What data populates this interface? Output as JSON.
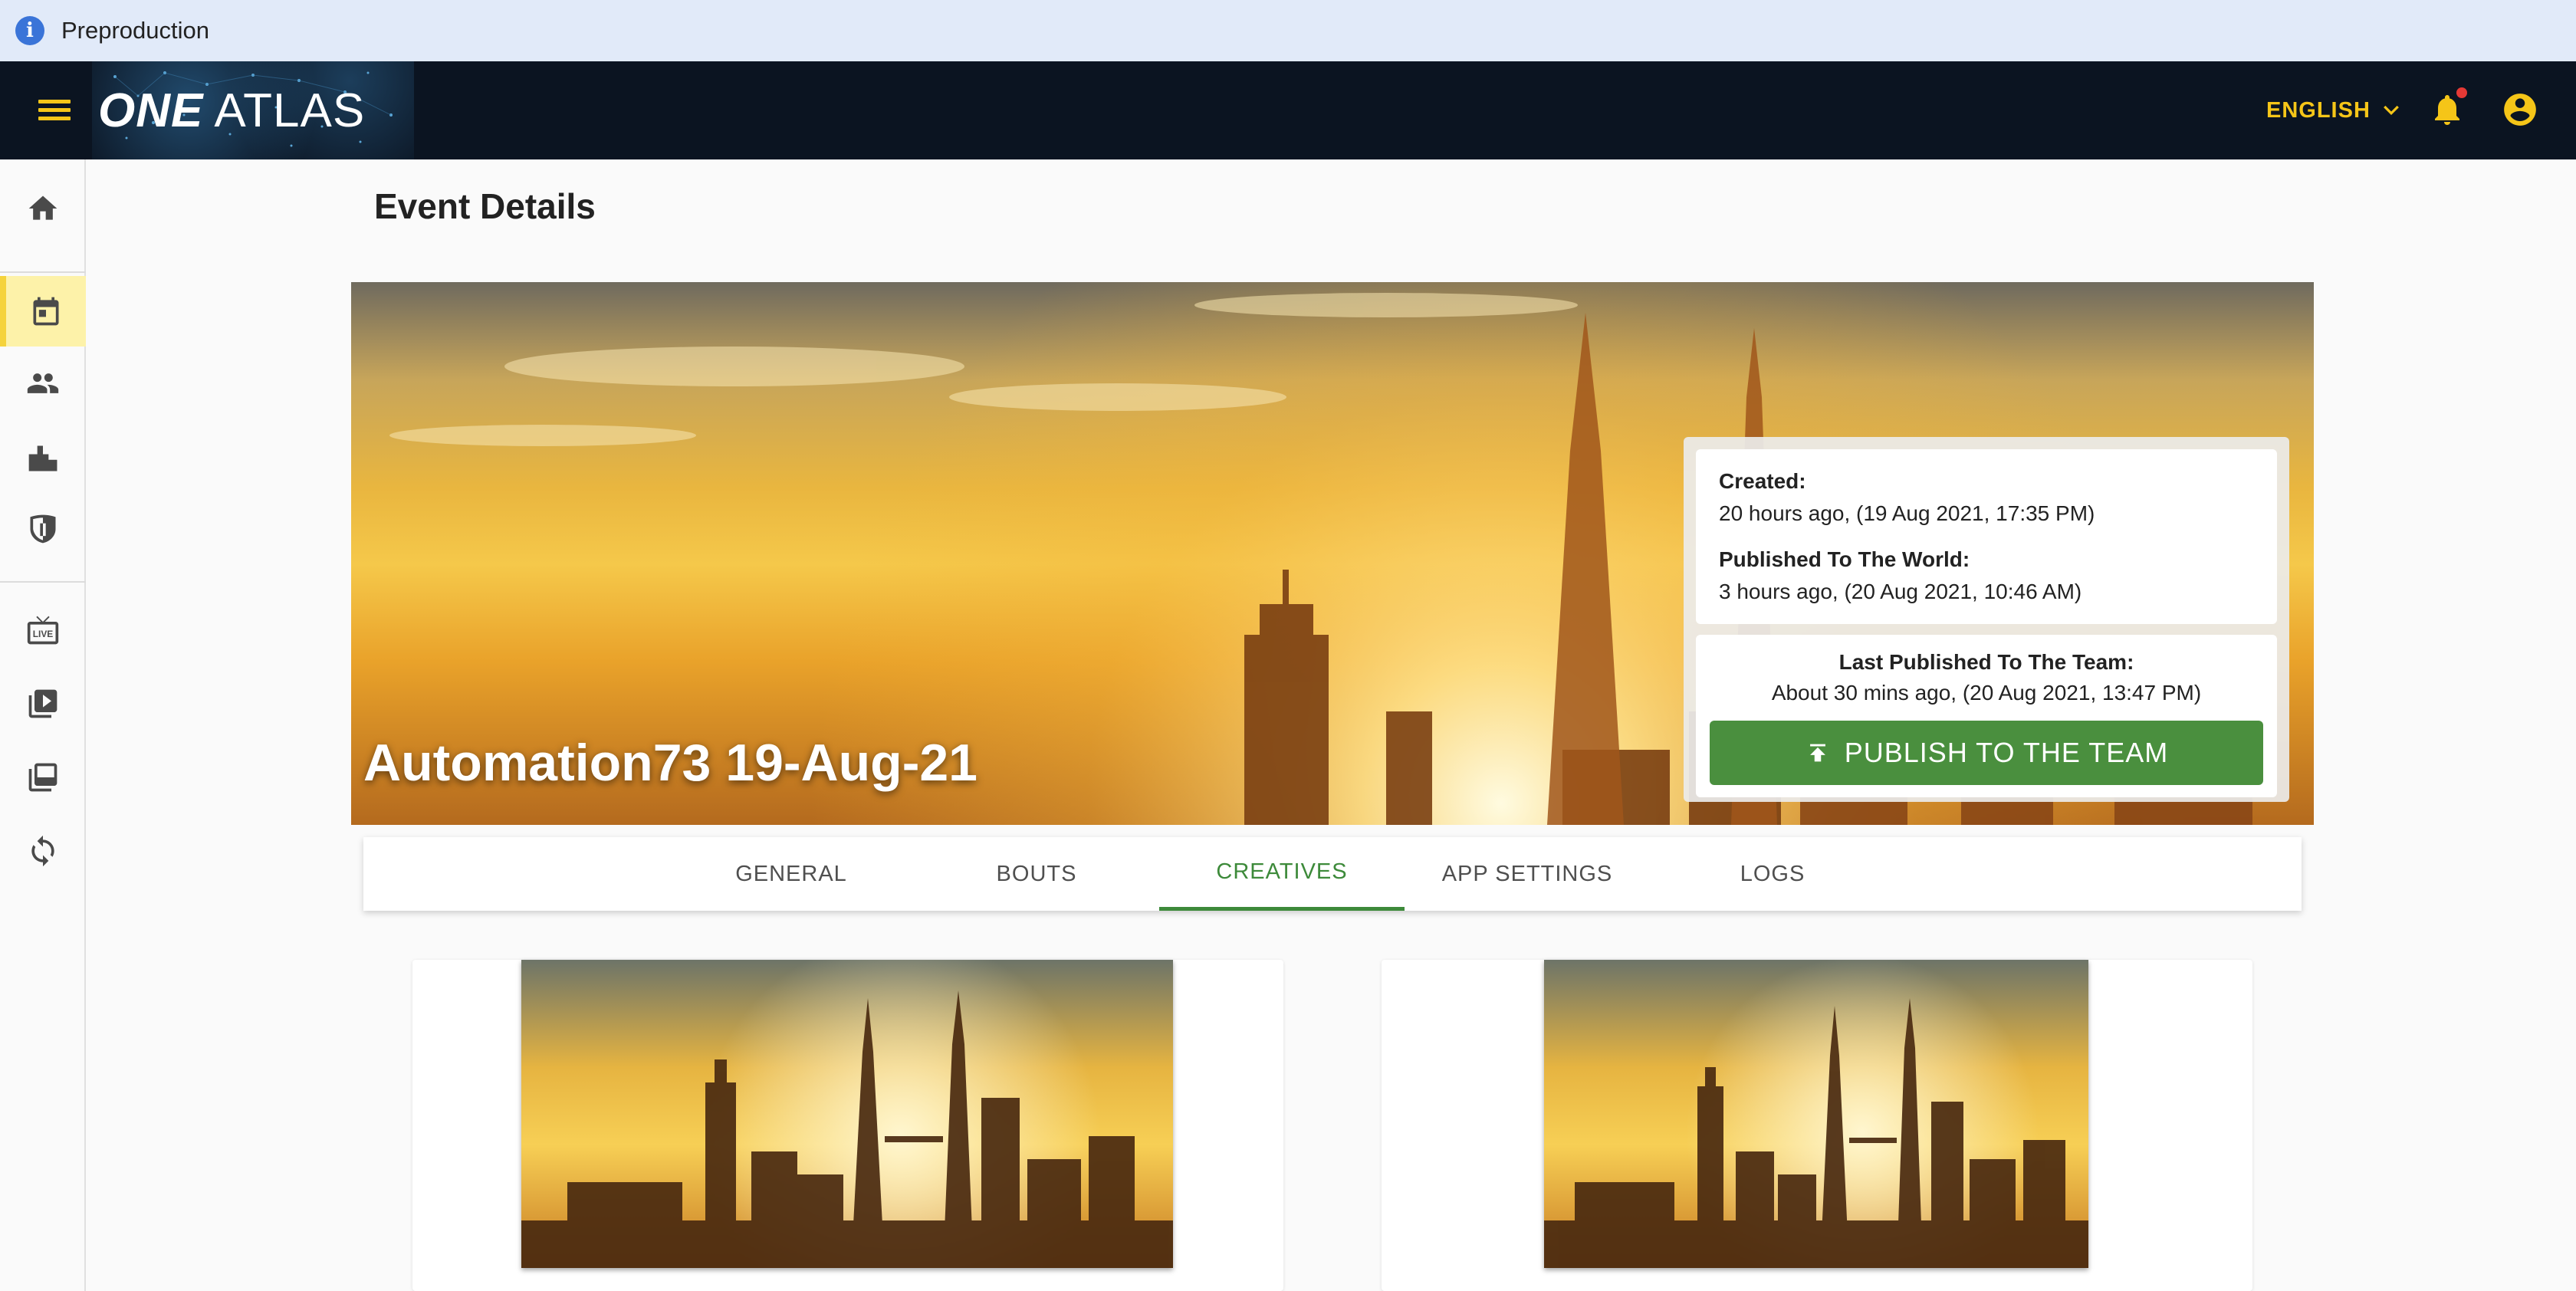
{
  "banner": {
    "label": "Preproduction",
    "icon": "info-icon"
  },
  "appbar": {
    "brand_one": "ONE",
    "brand_atlas": "ATLAS",
    "language": "ENGLISH",
    "accent": "#f5c518"
  },
  "nav": {
    "items": [
      {
        "icon": "home-icon"
      },
      {
        "icon": "calendar-icon",
        "active": true
      },
      {
        "icon": "people-icon"
      },
      {
        "icon": "podium-icon"
      },
      {
        "icon": "shield-icon"
      },
      {
        "icon": "live-tv-icon"
      },
      {
        "icon": "video-library-icon"
      },
      {
        "icon": "collections-icon"
      },
      {
        "icon": "sync-icon"
      }
    ]
  },
  "page": {
    "title": "Event Details"
  },
  "event": {
    "name": "Automation73 19-Aug-21",
    "created_label": "Created:",
    "created_value": "20 hours ago, (19 Aug 2021, 17:35 PM)",
    "world_label": "Published To The World:",
    "world_value": "3 hours ago, (20 Aug 2021, 10:46 AM)",
    "team_label": "Last Published To The Team:",
    "team_value": "About 30 mins ago, (20 Aug 2021, 13:47 PM)",
    "publish_button": "PUBLISH TO THE TEAM",
    "publish_color": "#4a8f3e"
  },
  "tabs": {
    "items": [
      "GENERAL",
      "BOUTS",
      "CREATIVES",
      "APP SETTINGS",
      "LOGS"
    ],
    "active": "CREATIVES",
    "active_color": "#3d8a3a"
  }
}
